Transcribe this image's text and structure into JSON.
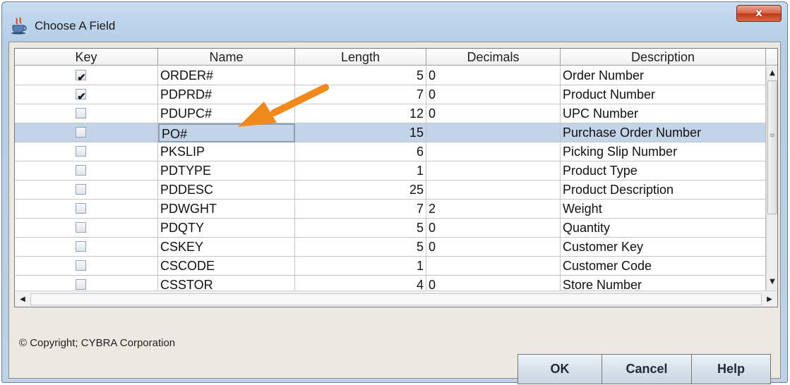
{
  "window": {
    "title": "Choose A Field",
    "close_label": "x"
  },
  "table": {
    "columns": [
      "Key",
      "Name",
      "Length",
      "Decimals",
      "Description"
    ],
    "rows": [
      {
        "key": true,
        "name": "ORDER#",
        "length": "5",
        "decimals": "0",
        "description": "Order Number"
      },
      {
        "key": true,
        "name": "PDPRD#",
        "length": "7",
        "decimals": "0",
        "description": "Product Number"
      },
      {
        "key": false,
        "name": "PDUPC#",
        "length": "12",
        "decimals": "0",
        "description": "UPC Number"
      },
      {
        "key": false,
        "name": "PO#",
        "length": "15",
        "decimals": "",
        "description": "Purchase Order Number",
        "selected": true
      },
      {
        "key": false,
        "name": "PKSLIP",
        "length": "6",
        "decimals": "",
        "description": "Picking Slip Number"
      },
      {
        "key": false,
        "name": "PDTYPE",
        "length": "1",
        "decimals": "",
        "description": "Product Type"
      },
      {
        "key": false,
        "name": "PDDESC",
        "length": "25",
        "decimals": "",
        "description": "Product Description"
      },
      {
        "key": false,
        "name": "PDWGHT",
        "length": "7",
        "decimals": "2",
        "description": "Weight"
      },
      {
        "key": false,
        "name": "PDQTY",
        "length": "5",
        "decimals": "0",
        "description": "Quantity"
      },
      {
        "key": false,
        "name": "CSKEY",
        "length": "5",
        "decimals": "0",
        "description": "Customer Key"
      },
      {
        "key": false,
        "name": "CSCODE",
        "length": "1",
        "decimals": "",
        "description": "Customer Code"
      },
      {
        "key": false,
        "name": "CSSTOR",
        "length": "4",
        "decimals": "0",
        "description": "Store Number"
      }
    ]
  },
  "footer": {
    "copyright": "© Copyright; CYBRA Corporation",
    "ok_label": "OK",
    "cancel_label": "Cancel",
    "help_label": "Help"
  },
  "colors": {
    "selection": "#c3d4e8",
    "annotation_arrow": "#f08a1c"
  }
}
